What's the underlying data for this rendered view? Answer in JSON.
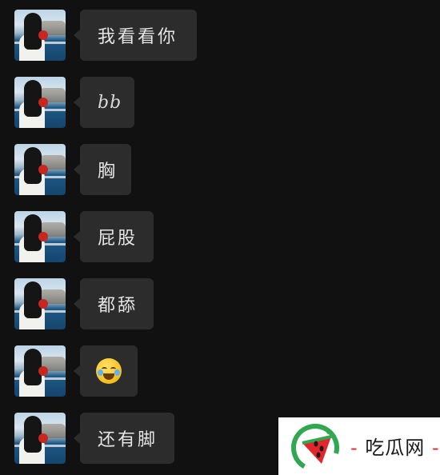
{
  "colors": {
    "background": "#111111",
    "bubble": "#2c2c2c",
    "bubble_text": "#e6e6e6",
    "watermark_bg": "#ffffff",
    "watermark_accent": "#e02a2a"
  },
  "messages": [
    {
      "type": "text",
      "text": "我看看你"
    },
    {
      "type": "text",
      "text": "bb"
    },
    {
      "type": "text",
      "text": "胸"
    },
    {
      "type": "text",
      "text": "屁股"
    },
    {
      "type": "text",
      "text": "都舔"
    },
    {
      "type": "emoji",
      "icon": "crying-laughing-emoji"
    },
    {
      "type": "text",
      "text": "还有脚"
    }
  ],
  "watermark": {
    "dash_left": "-",
    "name": "吃瓜网",
    "dash_right": "-",
    "logo_icon": "watermelon-logo-icon"
  }
}
